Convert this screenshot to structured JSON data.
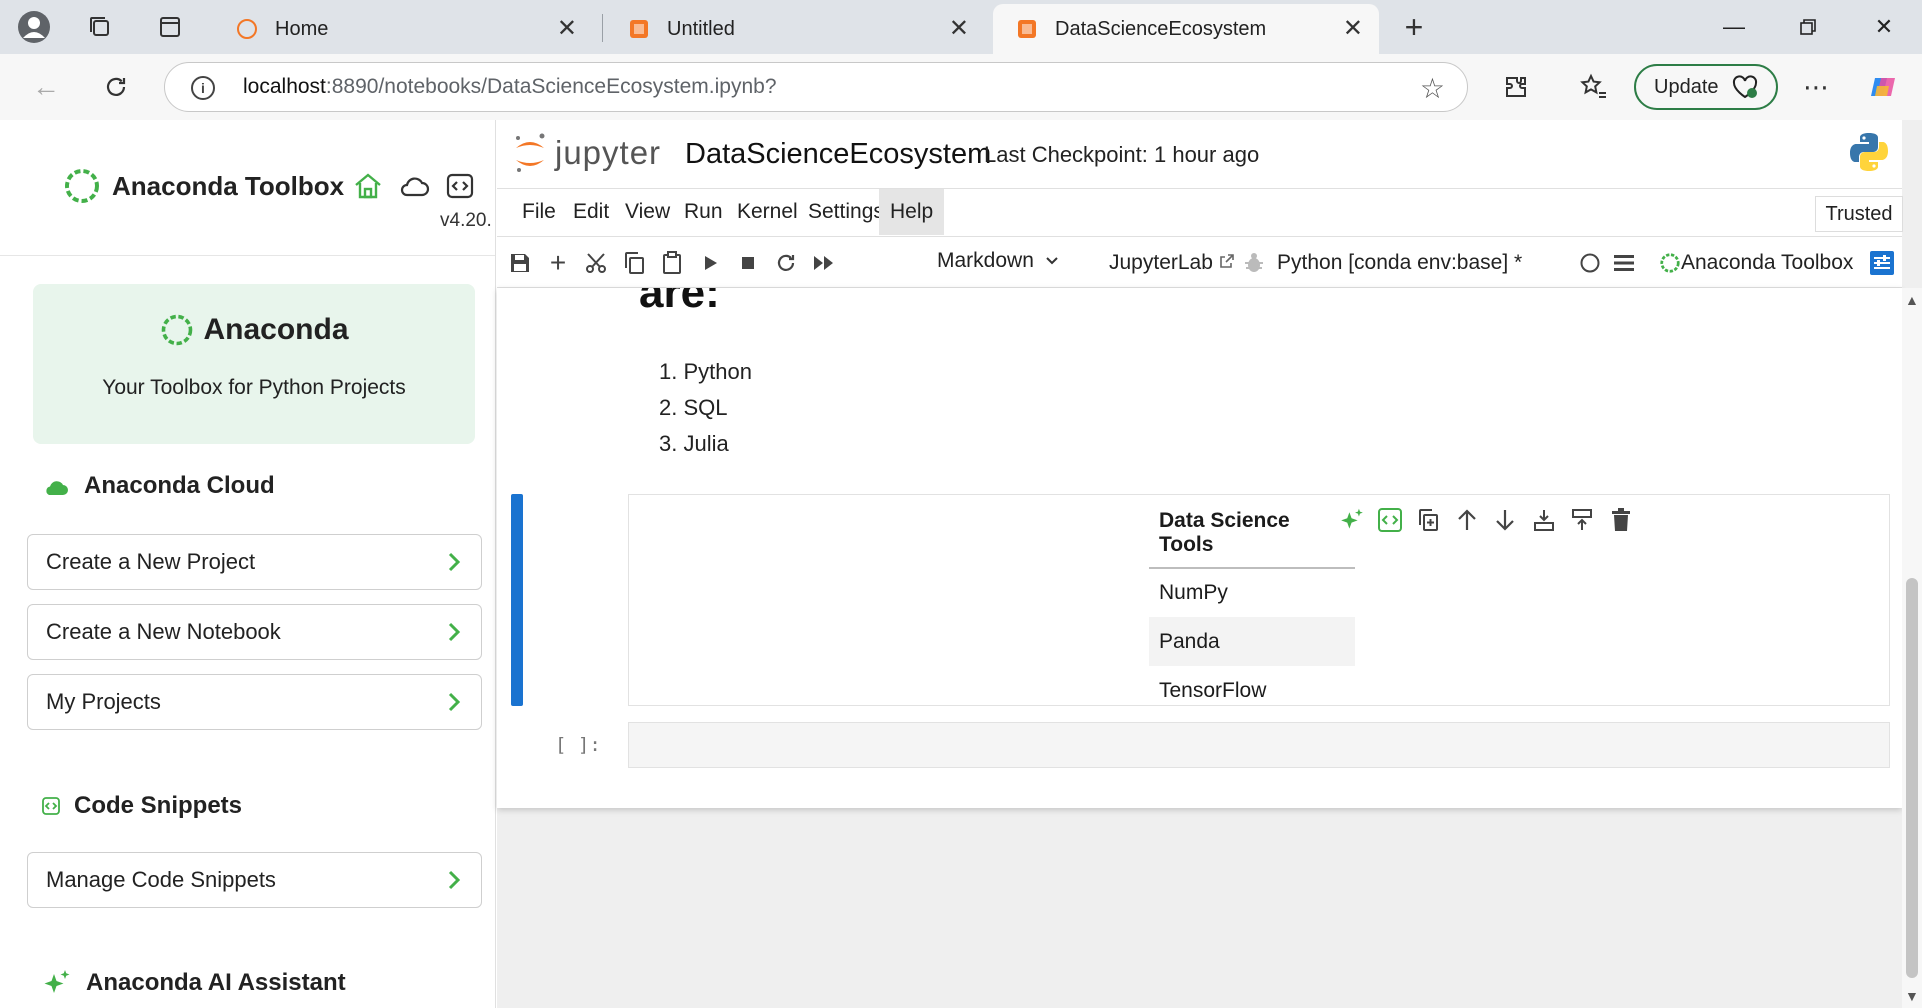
{
  "browser": {
    "tabs": [
      {
        "title": "Home",
        "icon": "jupyter-tab-icon"
      },
      {
        "title": "Untitled",
        "icon": "notebook-tab-icon"
      },
      {
        "title": "DataScienceEcosystem",
        "icon": "notebook-tab-icon",
        "active": true
      }
    ],
    "url_host": "localhost",
    "url_path": ":8890/notebooks/DataScienceEcosystem.ipynb?",
    "update_label": "Update"
  },
  "sidebar": {
    "title": "Anaconda Toolbox",
    "version": "v4.20.",
    "hero_title": "Anaconda",
    "hero_subtitle": "Your Toolbox for Python Projects",
    "cloud_section": "Anaconda Cloud",
    "cloud_items": [
      "Create a New Project",
      "Create a New Notebook",
      "My Projects"
    ],
    "snippets_section": "Code Snippets",
    "snippets_items": [
      "Manage Code Snippets"
    ],
    "ai_section": "Anaconda AI Assistant"
  },
  "jupyter": {
    "logo_word": "jupyter",
    "notebook_name": "DataScienceEcosystem",
    "checkpoint": "Last Checkpoint: 1 hour ago",
    "menu": [
      "File",
      "Edit",
      "View",
      "Run",
      "Kernel",
      "Settings",
      "Help"
    ],
    "trusted": "Trusted",
    "cell_type": "Markdown",
    "jupyterlab_link": "JupyterLab",
    "kernel": "Python [conda env:base] *",
    "toolbox_label": "Anaconda Toolbox"
  },
  "notebook": {
    "heading_tail": "are:",
    "languages": [
      "1. Python",
      "2. SQL",
      "3. Julia"
    ],
    "table_header": "Data Science Tools",
    "table_rows": [
      "NumPy",
      "Panda",
      "TensorFlow"
    ],
    "prompt": "[ ]:"
  },
  "colors": {
    "accent_blue": "#1a73d0",
    "anaconda_green": "#43b049",
    "jupyter_orange": "#f37726"
  }
}
